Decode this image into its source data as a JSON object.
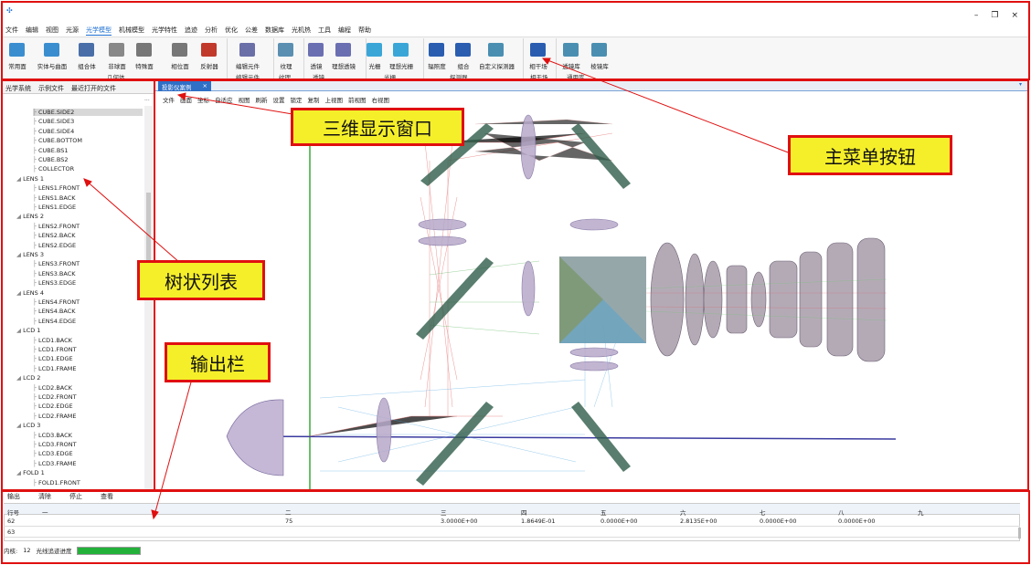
{
  "menu": [
    "文件",
    "编辑",
    "视图",
    "光源",
    "光学模型",
    "机械模型",
    "光学特性",
    "追迹",
    "分析",
    "优化",
    "公差",
    "数据库",
    "光机热",
    "工具",
    "编程",
    "帮助"
  ],
  "active_menu": "光学模型",
  "toolbar": {
    "buttons": [
      "常用面",
      "实体与曲面",
      "组合体",
      "非球面",
      "特殊面",
      "相位面",
      "反射器",
      "编辑元件",
      "纹理",
      "透镜",
      "理想透镜",
      "光栅",
      "理想光栅",
      "辐照度",
      "组合",
      "自定义探测器",
      "相干场",
      "透镜库",
      "棱镜库"
    ],
    "groups": [
      "几何体",
      "编辑元件",
      "纹理",
      "透镜",
      "光栅",
      "探测器",
      "相干场",
      "通用库"
    ]
  },
  "window_controls": [
    "–",
    "❐",
    "×"
  ],
  "left_tabs": [
    "光学系统",
    "示例文件",
    "最近打开的文件"
  ],
  "tree": [
    "CUBE.SIDE2",
    "CUBE.SIDE3",
    "CUBE.SIDE4",
    "CUBE.BOTTOM",
    "CUBE.BS1",
    "CUBE.BS2",
    "COLLECTOR",
    "LENS 1",
    "LENS1.FRONT",
    "LENS1.BACK",
    "LENS1.EDGE",
    "LENS 2",
    "LENS2.FRONT",
    "LENS2.BACK",
    "LENS2.EDGE",
    "LENS 3",
    "LENS3.FRONT",
    "LENS3.BACK",
    "LENS3.EDGE",
    "LENS 4",
    "LENS4.FRONT",
    "LENS4.BACK",
    "LENS4.EDGE",
    "LCD 1",
    "LCD1.BACK",
    "LCD1.FRONT",
    "LCD1.EDGE",
    "LCD1.FRAME",
    "LCD 2",
    "LCD2.BACK",
    "LCD2.FRONT",
    "LCD2.EDGE",
    "LCD2.FRAME",
    "LCD 3",
    "LCD3.BACK",
    "LCD3.FRONT",
    "LCD3.EDGE",
    "LCD3.FRAME",
    "FOLD 1",
    "FOLD1.FRONT"
  ],
  "tree_more": "···",
  "doc_tab": "投影仪案例",
  "view_menu": [
    "文件",
    "画面",
    "坐标",
    "自适应",
    "视图",
    "刷新",
    "设置",
    "锁定",
    "复制",
    "上视图",
    "前视图",
    "右视图"
  ],
  "callouts": {
    "view": "三维显示窗口",
    "menu": "主菜单按钮",
    "tree": "树状列表",
    "output": "输出栏"
  },
  "output_tabs": [
    "输出",
    "清除",
    "停止",
    "查看"
  ],
  "table": {
    "headers": [
      "行号",
      "一",
      "二",
      "三",
      "四",
      "五",
      "六",
      "七",
      "八",
      "九"
    ],
    "rows": [
      [
        "62",
        "",
        "75",
        "3.0000E+00",
        "1.8649E-01",
        "0.0000E+00",
        "2.8135E+00",
        "0.0000E+00",
        "0.0000E+00",
        ""
      ],
      [
        "63",
        "",
        "",
        "",
        "",
        "",
        "",
        "",
        "",
        ""
      ]
    ]
  },
  "status": {
    "cores_label": "内核:",
    "cores": "12",
    "progress_label": "光线追迹进度",
    "progress": 1.0,
    "progress_color": "#23b13a"
  },
  "colors": {
    "frame": "#e01010",
    "callout_bg": "#f5ef2a",
    "accent": "#1d6fd1"
  }
}
